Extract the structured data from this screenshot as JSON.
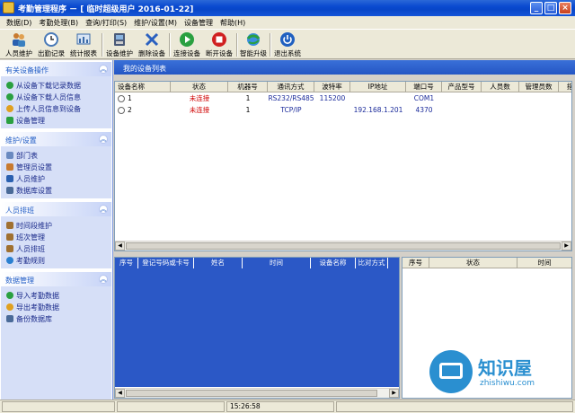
{
  "window": {
    "title": "考勤管理程序 － [ 临时超级用户 2016-01-22]"
  },
  "menu": [
    "数据(D)",
    "考勤处理(B)",
    "查询/打印(S)",
    "维护/设置(M)",
    "设备管理",
    "帮助(H)"
  ],
  "toolbar": [
    {
      "label": "人员维护",
      "icon": "people-icon",
      "color": "#c87a30"
    },
    {
      "label": "出勤记录",
      "icon": "clock-icon",
      "color": "#4a7ab8"
    },
    {
      "label": "统计报表",
      "icon": "report-icon",
      "color": "#3a6aa8"
    },
    {
      "label": "设备维护",
      "icon": "device-icon",
      "color": "#4a5a78"
    },
    {
      "label": "删除设备",
      "icon": "delete-icon",
      "color": "#2a60c0"
    },
    {
      "label": "连接设备",
      "icon": "connect-icon",
      "color": "#2aa040"
    },
    {
      "label": "断开设备",
      "icon": "disconnect-icon",
      "color": "#d02020"
    },
    {
      "label": "智能升级",
      "icon": "upgrade-icon",
      "color": "#2aa040"
    },
    {
      "label": "退出系统",
      "icon": "power-icon",
      "color": "#2060c0"
    }
  ],
  "sidebar": {
    "sections": [
      {
        "title": "有关设备操作",
        "items": [
          "从设备下载记录数据",
          "从设备下载人员信息",
          "上传人员信息到设备",
          "设备管理"
        ]
      },
      {
        "title": "维护/设置",
        "items": [
          "部门表",
          "管理员设置",
          "人员维护",
          "数据库设置"
        ]
      },
      {
        "title": "人员排班",
        "items": [
          "时间段维护",
          "班次管理",
          "人员排班",
          "考勤规则"
        ]
      },
      {
        "title": "数据管理",
        "items": [
          "导入考勤数据",
          "导出考勤数据",
          "备份数据库"
        ]
      }
    ]
  },
  "device_list": {
    "title": "我的设备列表",
    "columns": [
      "设备名称",
      "状态",
      "机器号",
      "通讯方式",
      "波特率",
      "IP地址",
      "端口号",
      "产品型号",
      "人员数",
      "管理员数",
      "指"
    ],
    "rows": [
      {
        "name": "1",
        "status": "未连接",
        "machine_no": "1",
        "comm": "RS232/RS485",
        "baud": "115200",
        "ip": "",
        "port": "COM1"
      },
      {
        "name": "2",
        "status": "未连接",
        "machine_no": "1",
        "comm": "TCP/IP",
        "baud": "",
        "ip": "192.168.1.201",
        "port": "4370"
      }
    ]
  },
  "records_table": {
    "columns": [
      "序号",
      "登记号码或卡号",
      "姓名",
      "时间",
      "设备名称",
      "比对方式"
    ]
  },
  "status_table": {
    "columns": [
      "序号",
      "状态",
      "时间"
    ]
  },
  "statusbar": {
    "time": "15:26:58"
  },
  "watermark": {
    "name": "知识屋",
    "url": "zhishiwu.com"
  }
}
